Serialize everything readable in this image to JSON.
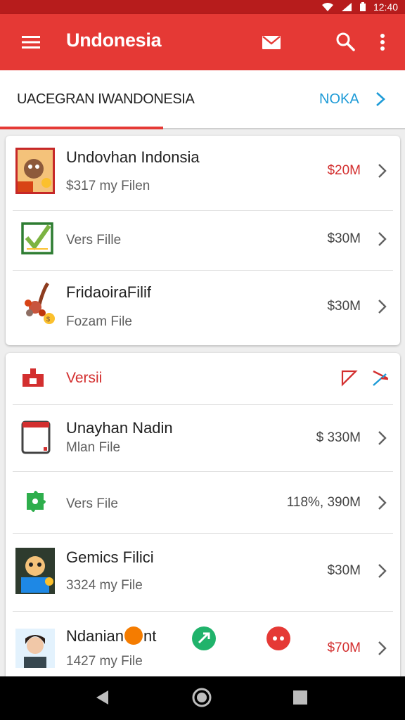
{
  "status_bar": {
    "time": "12:40"
  },
  "app_bar": {
    "title": "Undonesia"
  },
  "tab_bar": {
    "label": "UACEGRAN IWANDONESIA",
    "action": "NOKA"
  },
  "card1": {
    "items": [
      {
        "title": "Undovhan Indonsia",
        "subtitle": "$317 my Filen",
        "price": "$20M",
        "price_color": "#d32f2f"
      },
      {
        "title": "",
        "subtitle": "Vers Fille",
        "price": "$30M"
      },
      {
        "title": "FridaoiraFilif",
        "subtitle": "Fozam File",
        "price": "$30M"
      }
    ]
  },
  "card2": {
    "header": {
      "title": "Versii",
      "color": "#d32f2f"
    },
    "items": [
      {
        "title": "Unayhan Nadin",
        "subtitle": "Mlan File",
        "price": "$  330M"
      },
      {
        "title": "",
        "subtitle": "Vers File",
        "price": "118%, 390M"
      },
      {
        "title": "Gemics Filici",
        "subtitle": "3324 my File",
        "price": "$30M"
      },
      {
        "title": "Ndanian",
        "title_suffix": "nt",
        "subtitle": "1427 my File",
        "price": "$70M",
        "price_color": "#d32f2f"
      }
    ]
  },
  "colors": {
    "app_bar": "#e53935",
    "accent": "#1e9bd7",
    "price_red": "#d32f2f"
  }
}
